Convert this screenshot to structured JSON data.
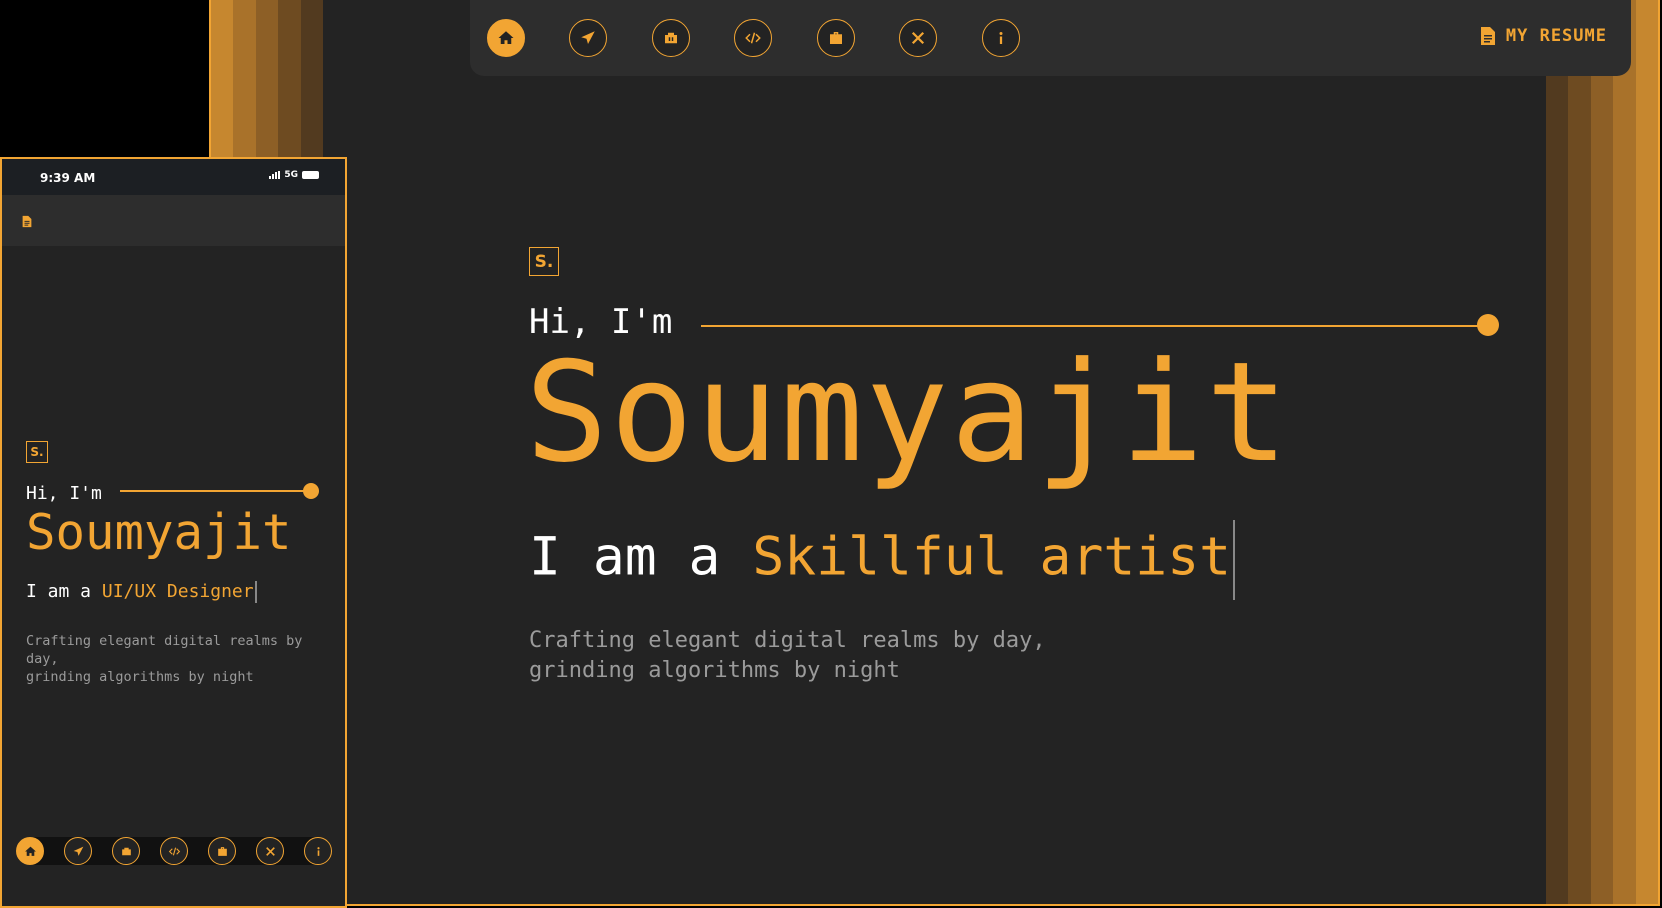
{
  "colors": {
    "accent": "#f2a533",
    "background": "#232323",
    "navbar": "#2d2d2d",
    "muted_text": "#9b9b9b"
  },
  "nav_icons": [
    "home-icon",
    "send-icon",
    "projects-icon",
    "code-icon",
    "briefcase-icon",
    "tools-icon",
    "info-icon"
  ],
  "desktop": {
    "resume_label": "MY RESUME",
    "logo": "S.",
    "greeting": "Hi, I'm",
    "name": "Soumyajit",
    "role_prefix": "I am a",
    "role": "Skillful artist",
    "description_line1": "Crafting elegant digital realms by day,",
    "description_line2": "grinding algorithms by night"
  },
  "mobile": {
    "status_time": "9:39 AM",
    "status_network": "5G",
    "logo": "S.",
    "greeting": "Hi, I'm",
    "name": "Soumyajit",
    "role_prefix": "I am a",
    "role": "UI/UX Designer",
    "description_line1": "Crafting elegant digital realms by day,",
    "description_line2": "grinding algorithms by night"
  }
}
